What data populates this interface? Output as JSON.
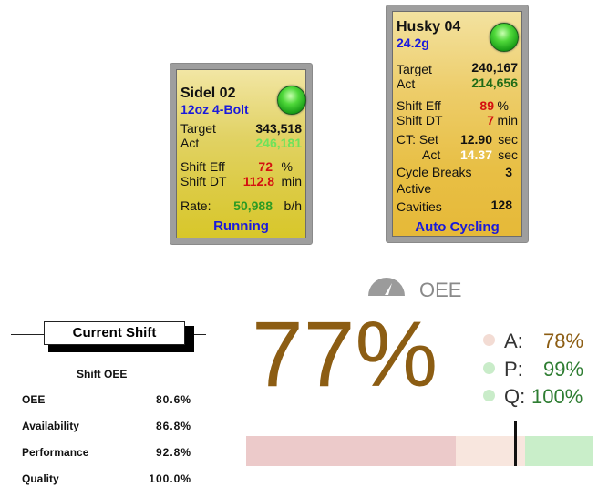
{
  "machines": {
    "sidel": {
      "name": "Sidel 02",
      "product": "12oz 4-Bolt",
      "target_label": "Target",
      "target_value": "343,518",
      "act_label": "Act",
      "act_value": "246,181",
      "shift_eff_label": "Shift Eff",
      "shift_eff_value": "72",
      "shift_eff_unit": "%",
      "shift_dt_label": "Shift DT",
      "shift_dt_value": "112.8",
      "shift_dt_unit": "min",
      "rate_label": "Rate:",
      "rate_value": "50,988",
      "rate_unit": "b/h",
      "status": "Running"
    },
    "husky": {
      "name": "Husky 04",
      "product": "24.2g",
      "target_label": "Target",
      "target_value": "240,167",
      "act_label": "Act",
      "act_value": "214,656",
      "shift_eff_label": "Shift Eff",
      "shift_eff_value": "89",
      "shift_eff_unit": "%",
      "shift_dt_label": "Shift DT",
      "shift_dt_value": "7",
      "shift_dt_unit": "min",
      "ct_set_label": "CT: Set",
      "ct_set_value": "12.90",
      "ct_set_unit": "sec",
      "ct_act_label": "Act",
      "ct_act_value": "14.37",
      "ct_act_unit": "sec",
      "cycle_breaks_label": "Cycle Breaks",
      "cycle_breaks_value": "3",
      "active_label": "Active",
      "cavities_label": "Cavities",
      "cavities_value": "128",
      "status": "Auto Cycling"
    }
  },
  "current_shift": {
    "title": "Current Shift",
    "subtitle": "Shift OEE",
    "rows": [
      {
        "label": "OEE",
        "value": "80.6%"
      },
      {
        "label": "Availability",
        "value": "86.8%"
      },
      {
        "label": "Performance",
        "value": "92.8%"
      },
      {
        "label": "Quality",
        "value": "100.0%"
      }
    ]
  },
  "oee_widget": {
    "title": "OEE",
    "value": "77%",
    "metrics": [
      {
        "letter": "A:",
        "value": "78%",
        "color": "#8c5d13",
        "dot": "#f3dcd4"
      },
      {
        "letter": "P:",
        "value": "99%",
        "color": "#2e7d32",
        "dot": "#c9ecc9"
      },
      {
        "letter": "Q:",
        "value": "100%",
        "color": "#2e7d32",
        "dot": "#c9ecc9"
      }
    ],
    "gauge": {
      "value_fraction": 0.77,
      "zones": [
        "#eccaca",
        "#f8e6de",
        "#c9eec9"
      ]
    }
  }
}
